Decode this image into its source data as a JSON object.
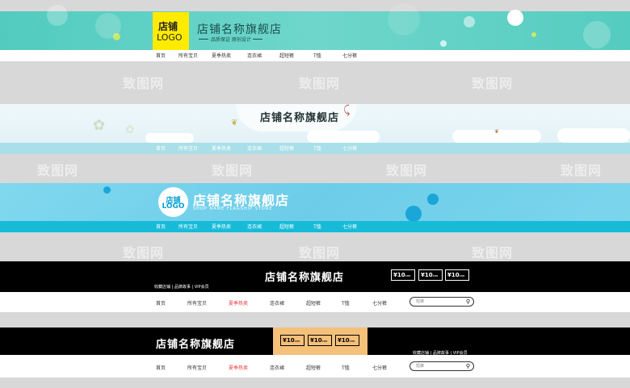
{
  "watermark": "致图网",
  "nav_items": [
    "首页",
    "所有宝贝",
    "夏季热卖",
    "连衣裙",
    "超短裤",
    "T恤",
    "七分裤"
  ],
  "banner1": {
    "logo_line1": "店铺",
    "logo_line2": "LOGO",
    "title": "店铺名称旗舰店",
    "subtitle": "品质保证 原创设计"
  },
  "banner2": {
    "title": "店铺名称旗舰店"
  },
  "banner3": {
    "logo_line1": "店铺",
    "logo_line2": "LOGO",
    "title": "店铺名称旗舰店",
    "subtitle": "SHOP NAME FLAGSHIP STORE"
  },
  "banner4": {
    "title": "店铺名称旗舰店",
    "links": "收藏店铺 | 品牌故事 | VIP会员",
    "prices": [
      {
        "currency": "¥",
        "value": "10",
        "unit": "RMB"
      },
      {
        "currency": "¥",
        "value": "10",
        "unit": "RMB"
      },
      {
        "currency": "¥",
        "value": "10",
        "unit": "RMB"
      }
    ],
    "search_placeholder": "短裤"
  },
  "banner5": {
    "title": "店铺名称旗舰店",
    "links": "收藏店铺 | 品牌故事 | VIP会员",
    "prices": [
      {
        "currency": "¥",
        "value": "10",
        "unit": "RMB"
      },
      {
        "currency": "¥",
        "value": "10",
        "unit": "RMB"
      },
      {
        "currency": "¥",
        "value": "10",
        "unit": "RMB"
      }
    ],
    "search_placeholder": "短裤"
  },
  "colors": {
    "teal": "#5ccfc4",
    "sky": "#7dd6ec",
    "cyan_nav": "#17bbd8",
    "pale_nav": "#a9dfe9",
    "yellow": "#ffeb00",
    "orange": "#f4c07a",
    "hot": "#e4393c"
  }
}
